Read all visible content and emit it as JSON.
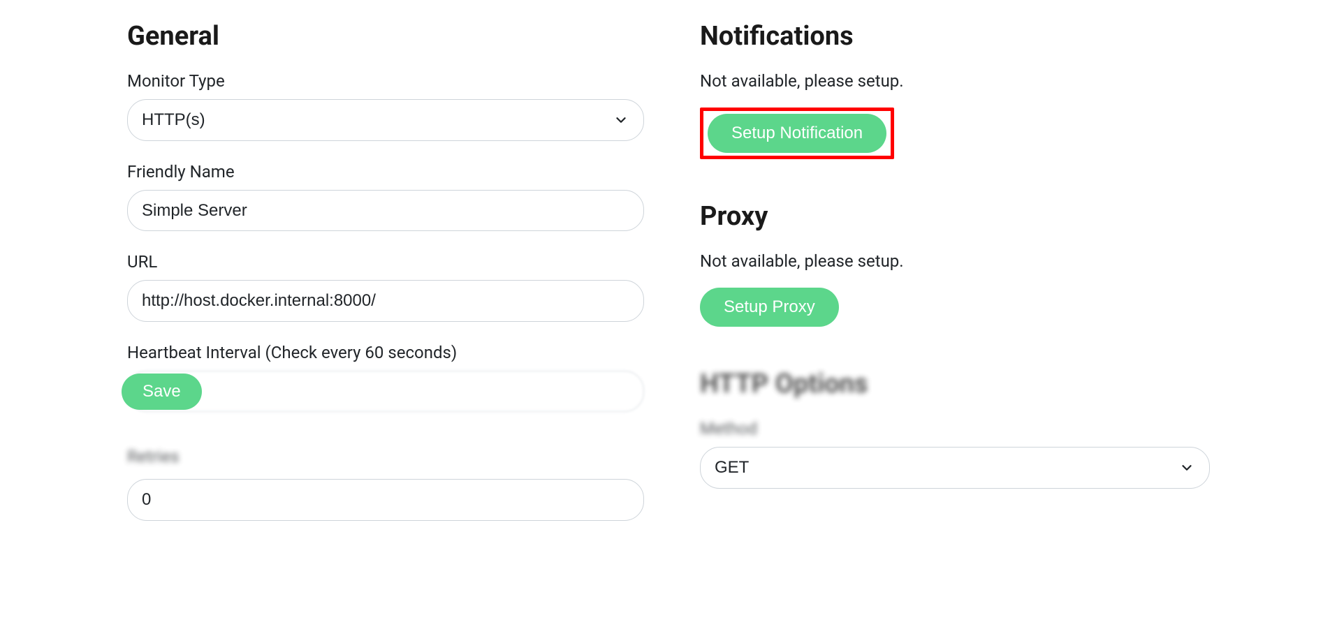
{
  "general": {
    "title": "General",
    "monitor_type_label": "Monitor Type",
    "monitor_type_value": "HTTP(s)",
    "friendly_name_label": "Friendly Name",
    "friendly_name_value": "Simple Server",
    "url_label": "URL",
    "url_value": "http://host.docker.internal:8000/",
    "heartbeat_label": "Heartbeat Interval (Check every 60 seconds)",
    "heartbeat_value": "",
    "retries_label": "Retries",
    "retries_value": "0",
    "save_label": "Save"
  },
  "notifications": {
    "title": "Notifications",
    "help": "Not available, please setup.",
    "setup_label": "Setup Notification"
  },
  "proxy": {
    "title": "Proxy",
    "help": "Not available, please setup.",
    "setup_label": "Setup Proxy"
  },
  "http_options": {
    "title": "HTTP Options",
    "method_label": "Method",
    "method_value": "GET"
  }
}
